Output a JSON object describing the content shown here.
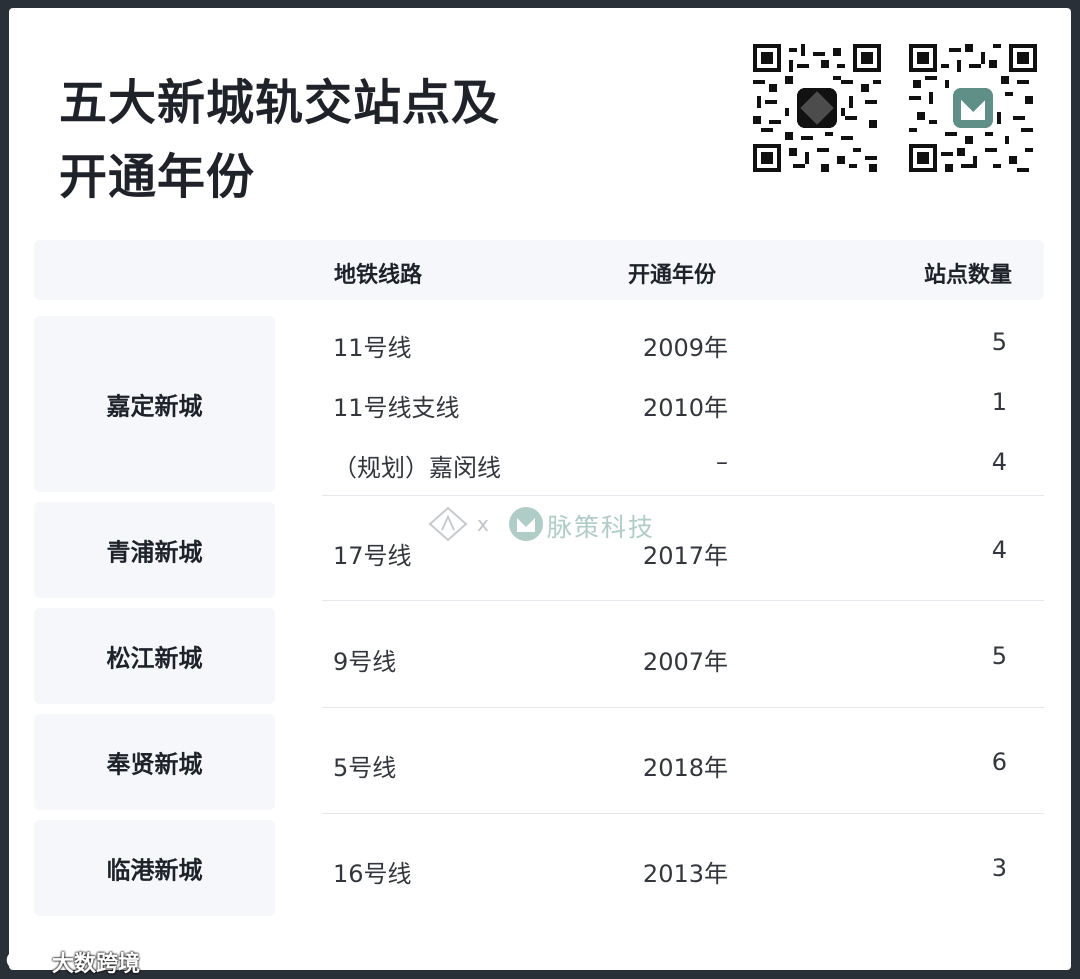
{
  "title": {
    "line1": "五大新城轨交站点及",
    "line2": "开通年份"
  },
  "header": {
    "line": "地铁线路",
    "year": "开通年份",
    "count": "站点数量"
  },
  "cities": [
    {
      "name": "嘉定新城"
    },
    {
      "name": "青浦新城"
    },
    {
      "name": "松江新城"
    },
    {
      "name": "奉贤新城"
    },
    {
      "name": "临港新城"
    }
  ],
  "rows": [
    {
      "line": "11号线",
      "year": "2009年",
      "count": "5"
    },
    {
      "line": "11号线支线",
      "year": "2010年",
      "count": "1"
    },
    {
      "line": "（规划）嘉闵线",
      "year": "–",
      "count": "4"
    },
    {
      "line": "17号线",
      "year": "2017年",
      "count": "4"
    },
    {
      "line": "9号线",
      "year": "2007年",
      "count": "5"
    },
    {
      "line": "5号线",
      "year": "2018年",
      "count": "6"
    },
    {
      "line": "16号线",
      "year": "2013年",
      "count": "3"
    }
  ],
  "watermark": {
    "x": "x",
    "brand": "脉策科技"
  },
  "corner_mark": "大数跨境",
  "colors": {
    "text": "#1f2329",
    "panel": "#f5f7fa",
    "frame": "#2a3038",
    "watermark": "#6fa39a"
  }
}
